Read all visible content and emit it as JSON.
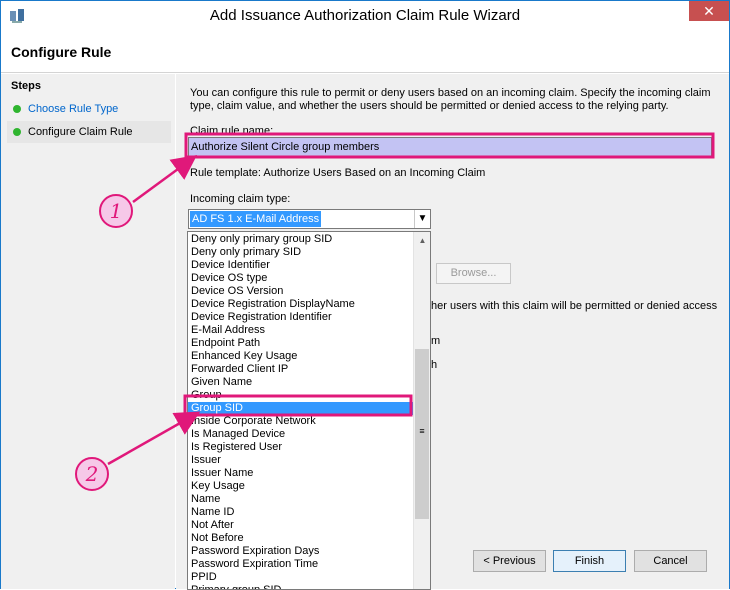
{
  "window": {
    "title": "Add Issuance Authorization Claim Rule Wizard",
    "close_label": "✕"
  },
  "header": {
    "title": "Configure Rule"
  },
  "steps": {
    "title": "Steps",
    "items": [
      {
        "label": "Choose Rule Type",
        "state": "done-link"
      },
      {
        "label": "Configure Claim Rule",
        "state": "current"
      }
    ]
  },
  "main": {
    "description": "You can configure this rule to permit or deny users based on an incoming claim. Specify the incoming claim type, claim value, and whether the users should be permitted or denied access to the relying party.",
    "rule_name_label": "Claim rule name:",
    "rule_name_value": "Authorize Silent Circle group members",
    "rule_template_text": "Rule template: Authorize Users Based on an Incoming Claim",
    "incoming_claim_label": "Incoming claim type:",
    "incoming_claim_value": "AD FS 1.x E-Mail Address",
    "browse_label": "Browse...",
    "partial_text_1": "her users with this claim will be permitted or denied access",
    "partial_text_2": "m",
    "partial_text_3": "h"
  },
  "dropdown": {
    "items": [
      "Deny only primary group SID",
      "Deny only primary SID",
      "Device Identifier",
      "Device OS type",
      "Device OS Version",
      "Device Registration DisplayName",
      "Device Registration Identifier",
      "E-Mail Address",
      "Endpoint Path",
      "Enhanced Key Usage",
      "Forwarded Client IP",
      "Given Name",
      "Group",
      "Group SID",
      "Inside Corporate Network",
      "Is Managed Device",
      "Is Registered User",
      "Issuer",
      "Issuer Name",
      "Key Usage",
      "Name",
      "Name ID",
      "Not After",
      "Not Before",
      "Password Expiration Days",
      "Password Expiration Time",
      "PPID",
      "Primary group SID"
    ],
    "selected": "Group SID"
  },
  "footer": {
    "previous_label": "< Previous",
    "finish_label": "Finish",
    "cancel_label": "Cancel"
  },
  "annotations": {
    "callout_1": "1",
    "callout_2": "2",
    "color": "#e0187a"
  }
}
